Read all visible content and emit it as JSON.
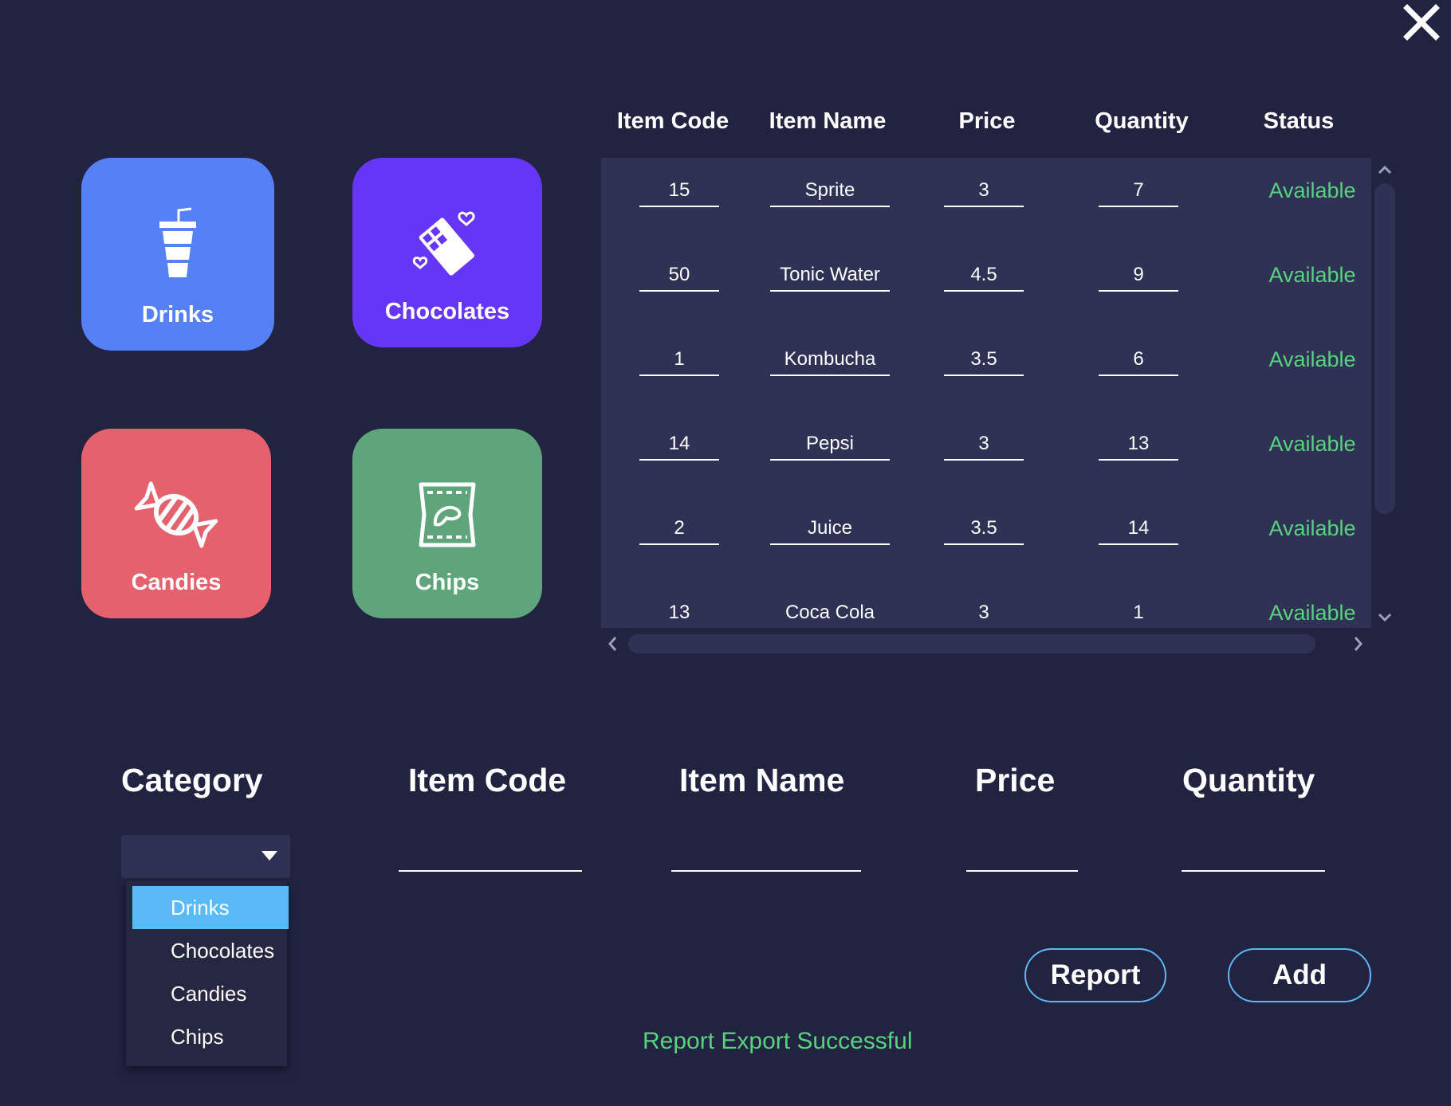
{
  "icons": {
    "close": "close-icon",
    "drinks": "cup-icon",
    "chocolates": "chocolate-bar-icon",
    "candies": "candy-icon",
    "chips": "chips-bag-icon"
  },
  "categories_tiles": [
    {
      "label": "Drinks",
      "color": "#5680f6"
    },
    {
      "label": "Chocolates",
      "color": "#6636f6"
    },
    {
      "label": "Candies",
      "color": "#e5616d"
    },
    {
      "label": "Chips",
      "color": "#5ea57c"
    }
  ],
  "table": {
    "headers": [
      "Item Code",
      "Item Name",
      "Price",
      "Quantity",
      "Status"
    ],
    "rows": [
      {
        "code": "15",
        "name": "Sprite",
        "price": "3",
        "qty": "7",
        "status": "Available"
      },
      {
        "code": "50",
        "name": "Tonic Water",
        "price": "4.5",
        "qty": "9",
        "status": "Available"
      },
      {
        "code": "1",
        "name": "Kombucha",
        "price": "3.5",
        "qty": "6",
        "status": "Available"
      },
      {
        "code": "14",
        "name": "Pepsi",
        "price": "3",
        "qty": "13",
        "status": "Available"
      },
      {
        "code": "2",
        "name": "Juice",
        "price": "3.5",
        "qty": "14",
        "status": "Available"
      },
      {
        "code": "13",
        "name": "Coca Cola",
        "price": "3",
        "qty": "1",
        "status": "Available"
      }
    ]
  },
  "form": {
    "category_label": "Category",
    "code_label": "Item Code",
    "name_label": "Item Name",
    "price_label": "Price",
    "quantity_label": "Quantity",
    "category_value": "",
    "code_value": "",
    "name_value": "",
    "price_value": "",
    "quantity_value": "",
    "dropdown_options": [
      "Drinks",
      "Chocolates",
      "Candies",
      "Chips"
    ],
    "dropdown_selected": "Drinks"
  },
  "buttons": {
    "report": "Report",
    "add": "Add"
  },
  "status_message": "Report Export Successful",
  "colors": {
    "background": "#212341",
    "panel": "#2f3155",
    "available": "#56d37c",
    "accent": "#5bbaf6"
  }
}
